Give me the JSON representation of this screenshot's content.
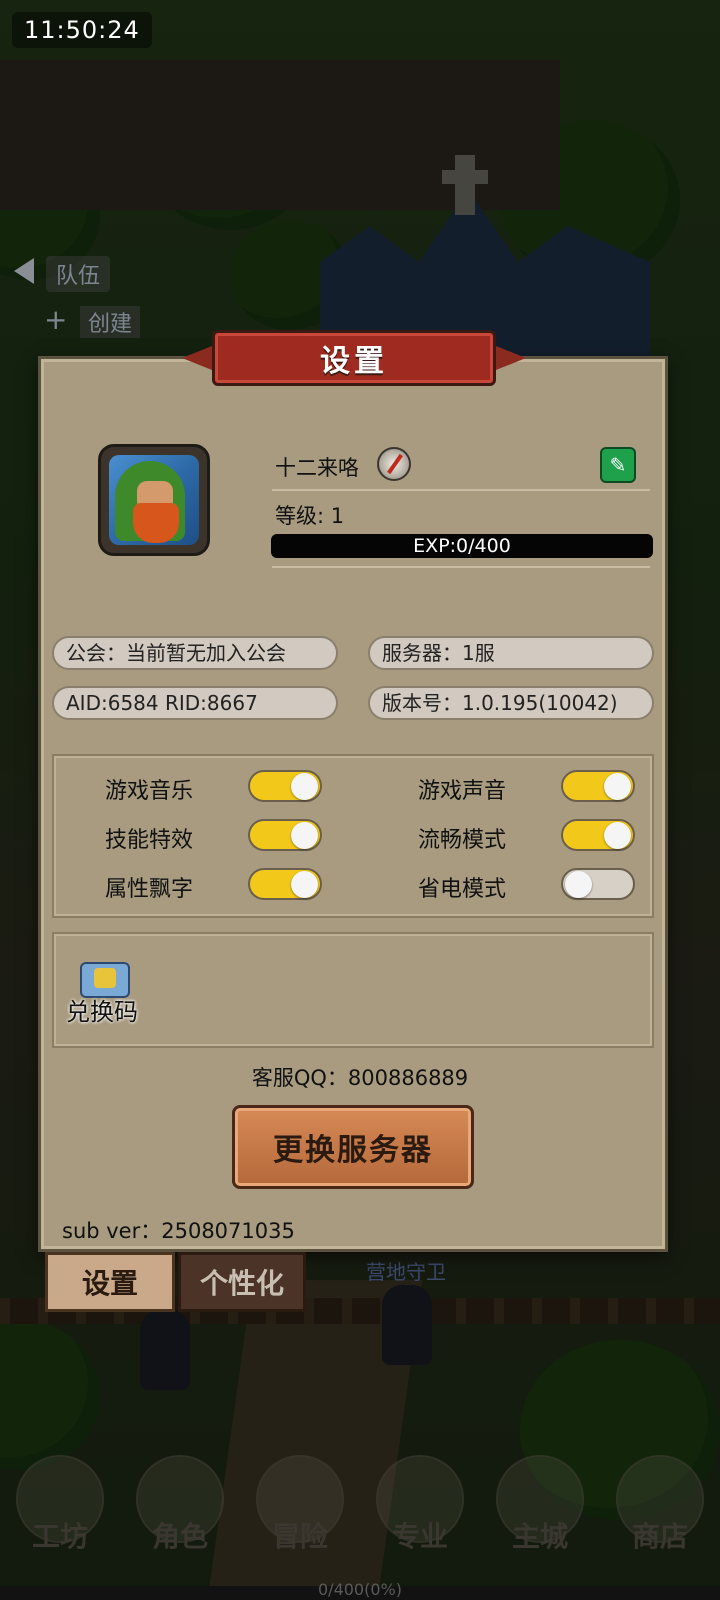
{
  "status": {
    "time": "11:50:24"
  },
  "team_menu": {
    "team_label": "队伍",
    "create_label": "创建"
  },
  "dialog": {
    "title": "设置",
    "profile": {
      "player_name": "十二来咯",
      "level": "等级: 1",
      "exp": "EXP:0/400"
    },
    "info": {
      "guild": "公会：当前暂无加入公会",
      "server": "服务器：1服",
      "ids": "AID:6584  RID:8667",
      "version": "版本号：1.0.195(10042)"
    },
    "toggles": [
      {
        "label": "游戏音乐",
        "state": "on"
      },
      {
        "label": "游戏声音",
        "state": "on"
      },
      {
        "label": "技能特效",
        "state": "on"
      },
      {
        "label": "流畅模式",
        "state": "on"
      },
      {
        "label": "属性飘字",
        "state": "on"
      },
      {
        "label": "省电模式",
        "state": "off"
      }
    ],
    "redeem_label": "兑换码",
    "support_qq": "客服QQ：800886889",
    "change_server_label": "更换服务器",
    "sub_ver": "sub ver：2508071035"
  },
  "tabs": {
    "settings": "设置",
    "personalization": "个性化"
  },
  "background": {
    "camp_guard_label": "营地守卫"
  },
  "bottom_nav": [
    {
      "label": "工坊",
      "icon": "workshop-icon"
    },
    {
      "label": "角色",
      "icon": "character-icon"
    },
    {
      "label": "冒险",
      "icon": "adventure-icon"
    },
    {
      "label": "专业",
      "icon": "profession-icon"
    },
    {
      "label": "主城",
      "icon": "main-city-icon"
    },
    {
      "label": "商店",
      "icon": "shop-icon"
    }
  ],
  "xp_progress": "0/400(0%)",
  "colors": {
    "toggle_on": "#f2c81a",
    "toggle_off": "#d6d0c6",
    "panel": "#a89b80",
    "banner": "#9e2a20",
    "edit": "#1fa04a"
  }
}
